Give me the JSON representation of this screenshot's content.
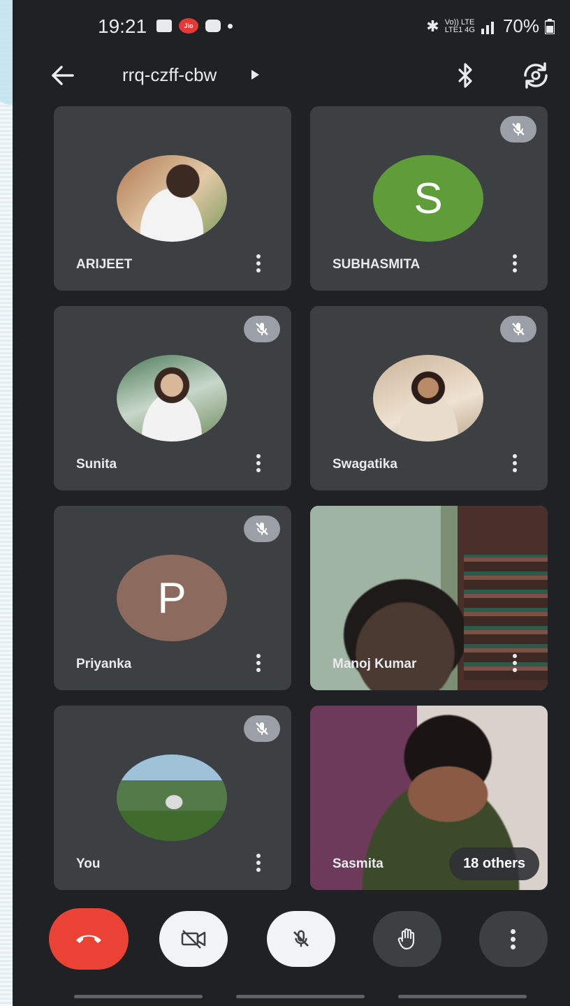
{
  "status_bar": {
    "time": "19:21",
    "network_small_top": "Vo)) LTE",
    "network_small_bottom": "LTE1 4G",
    "battery": "70%",
    "jio_label": "Jio"
  },
  "top_bar": {
    "meeting_code": "rrq-czff-cbw"
  },
  "participants": [
    {
      "name": "ARIJEET",
      "avatar": "photo",
      "muted": false
    },
    {
      "name": "SUBHASMITA",
      "avatar": "letter",
      "letter": "S",
      "avatar_color": "#5e9d3a",
      "muted": true
    },
    {
      "name": "Sunita",
      "avatar": "photo",
      "muted": true
    },
    {
      "name": "Swagatika",
      "avatar": "photo",
      "muted": true
    },
    {
      "name": "Priyanka",
      "avatar": "letter",
      "letter": "P",
      "avatar_color": "#8d6a5e",
      "muted": true
    },
    {
      "name": "Manoj Kumar",
      "avatar": "video",
      "muted": false
    },
    {
      "name": "You",
      "avatar": "photo",
      "muted": true
    },
    {
      "name": "Sasmita",
      "avatar": "video",
      "muted": false
    }
  ],
  "others_chip": "18 others",
  "controls": [
    {
      "name": "end-call",
      "icon": "phone-hangup-icon",
      "color": "#ea4335"
    },
    {
      "name": "camera-off",
      "icon": "camera-off-icon"
    },
    {
      "name": "mic-off",
      "icon": "mic-off-icon"
    },
    {
      "name": "raise-hand",
      "icon": "hand-icon"
    },
    {
      "name": "more-options",
      "icon": "more-vert-icon"
    }
  ]
}
